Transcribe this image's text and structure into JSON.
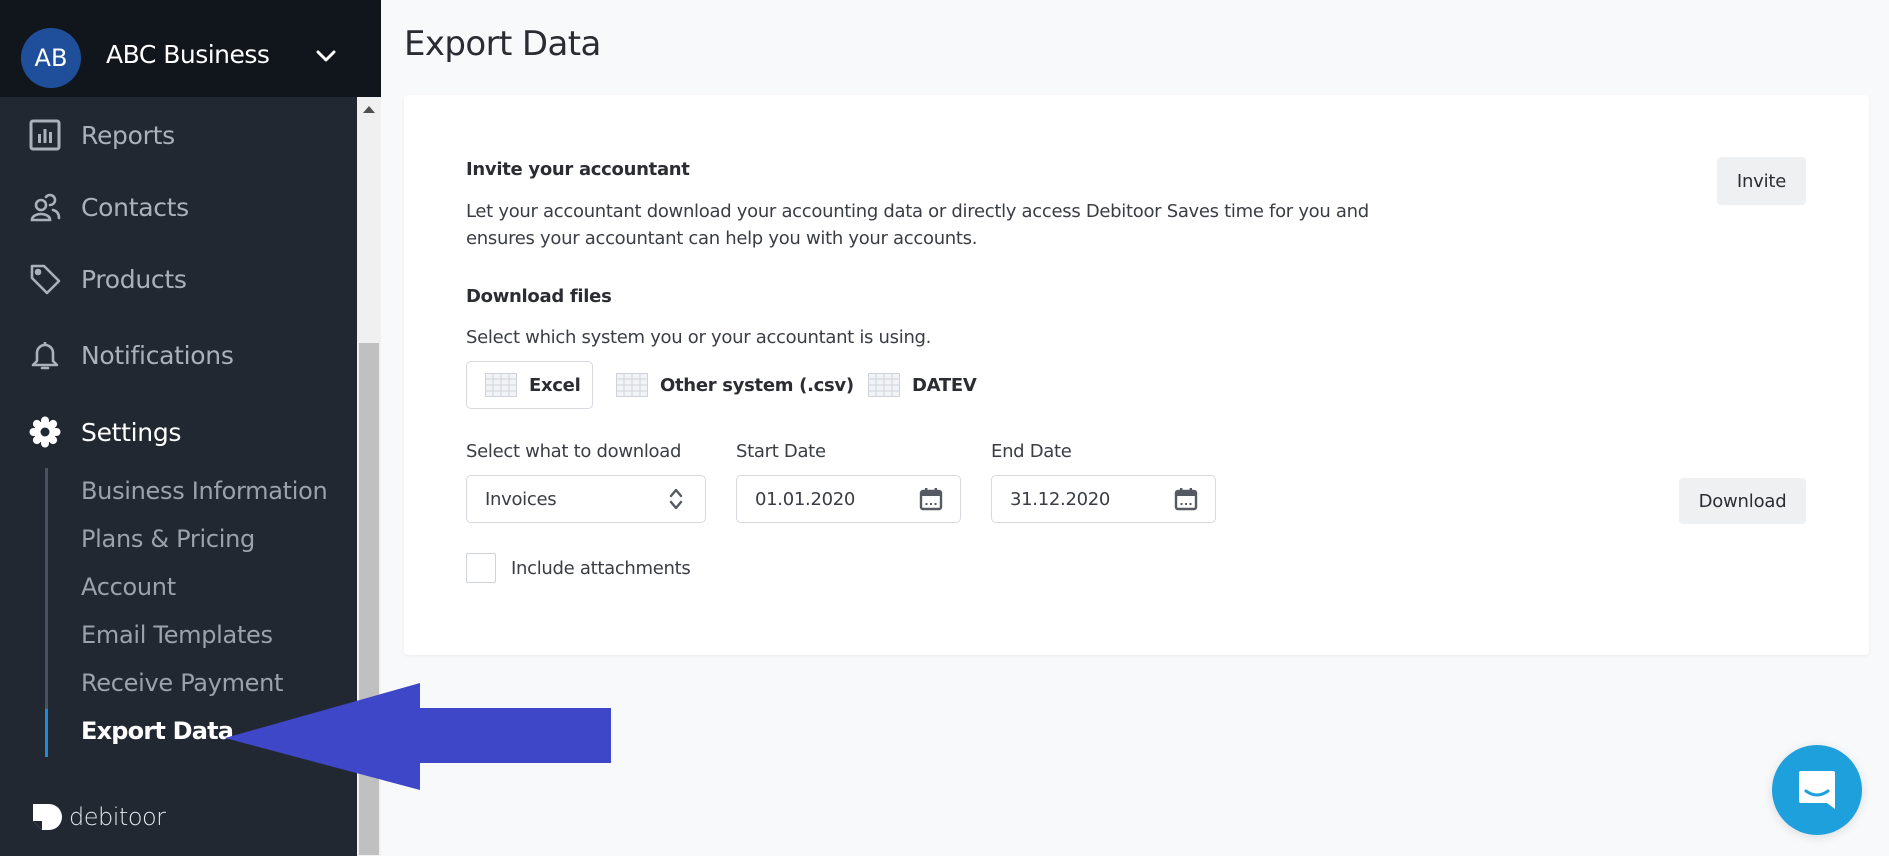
{
  "sidebar": {
    "avatar_initials": "AB",
    "business_name": "ABC Business",
    "nav": [
      {
        "label": "Reports",
        "icon": "reports-icon"
      },
      {
        "label": "Contacts",
        "icon": "contacts-icon"
      },
      {
        "label": "Products",
        "icon": "tag-icon"
      },
      {
        "label": "Notifications",
        "icon": "bell-icon"
      },
      {
        "label": "Settings",
        "icon": "gear-icon",
        "active": true
      }
    ],
    "settings_subnav": [
      {
        "label": "Business Information"
      },
      {
        "label": "Plans & Pricing"
      },
      {
        "label": "Account"
      },
      {
        "label": "Email Templates"
      },
      {
        "label": "Receive Payment"
      },
      {
        "label": "Export Data",
        "active": true
      }
    ],
    "logo_text": "debitoor"
  },
  "main": {
    "page_title": "Export Data",
    "invite": {
      "title": "Invite your accountant",
      "description_line1": "Let your accountant download your accounting data or directly access Debitoor Saves time for you and",
      "description_line2": "ensures your accountant can help you with your accounts.",
      "button_label": "Invite"
    },
    "download": {
      "title": "Download files",
      "subtitle": "Select which system you or your accountant is using.",
      "systems": [
        {
          "label": "Excel",
          "selected": true
        },
        {
          "label": "Other system (.csv)",
          "selected": false
        },
        {
          "label": "DATEV",
          "selected": false
        }
      ],
      "what_label": "Select what to download",
      "what_value": "Invoices",
      "start_label": "Start Date",
      "start_value": "01.01.2020",
      "end_label": "End Date",
      "end_value": "31.12.2020",
      "include_attachments_label": "Include attachments",
      "include_attachments_checked": false,
      "button_label": "Download"
    }
  },
  "colors": {
    "sidebar_bg": "#212832",
    "sidebar_header_bg": "#11151c",
    "avatar_bg": "#1f4f9b",
    "active_indicator": "#1e8ed0",
    "annotation_arrow": "#3f47c9",
    "chat_button": "#1ea0dc"
  }
}
